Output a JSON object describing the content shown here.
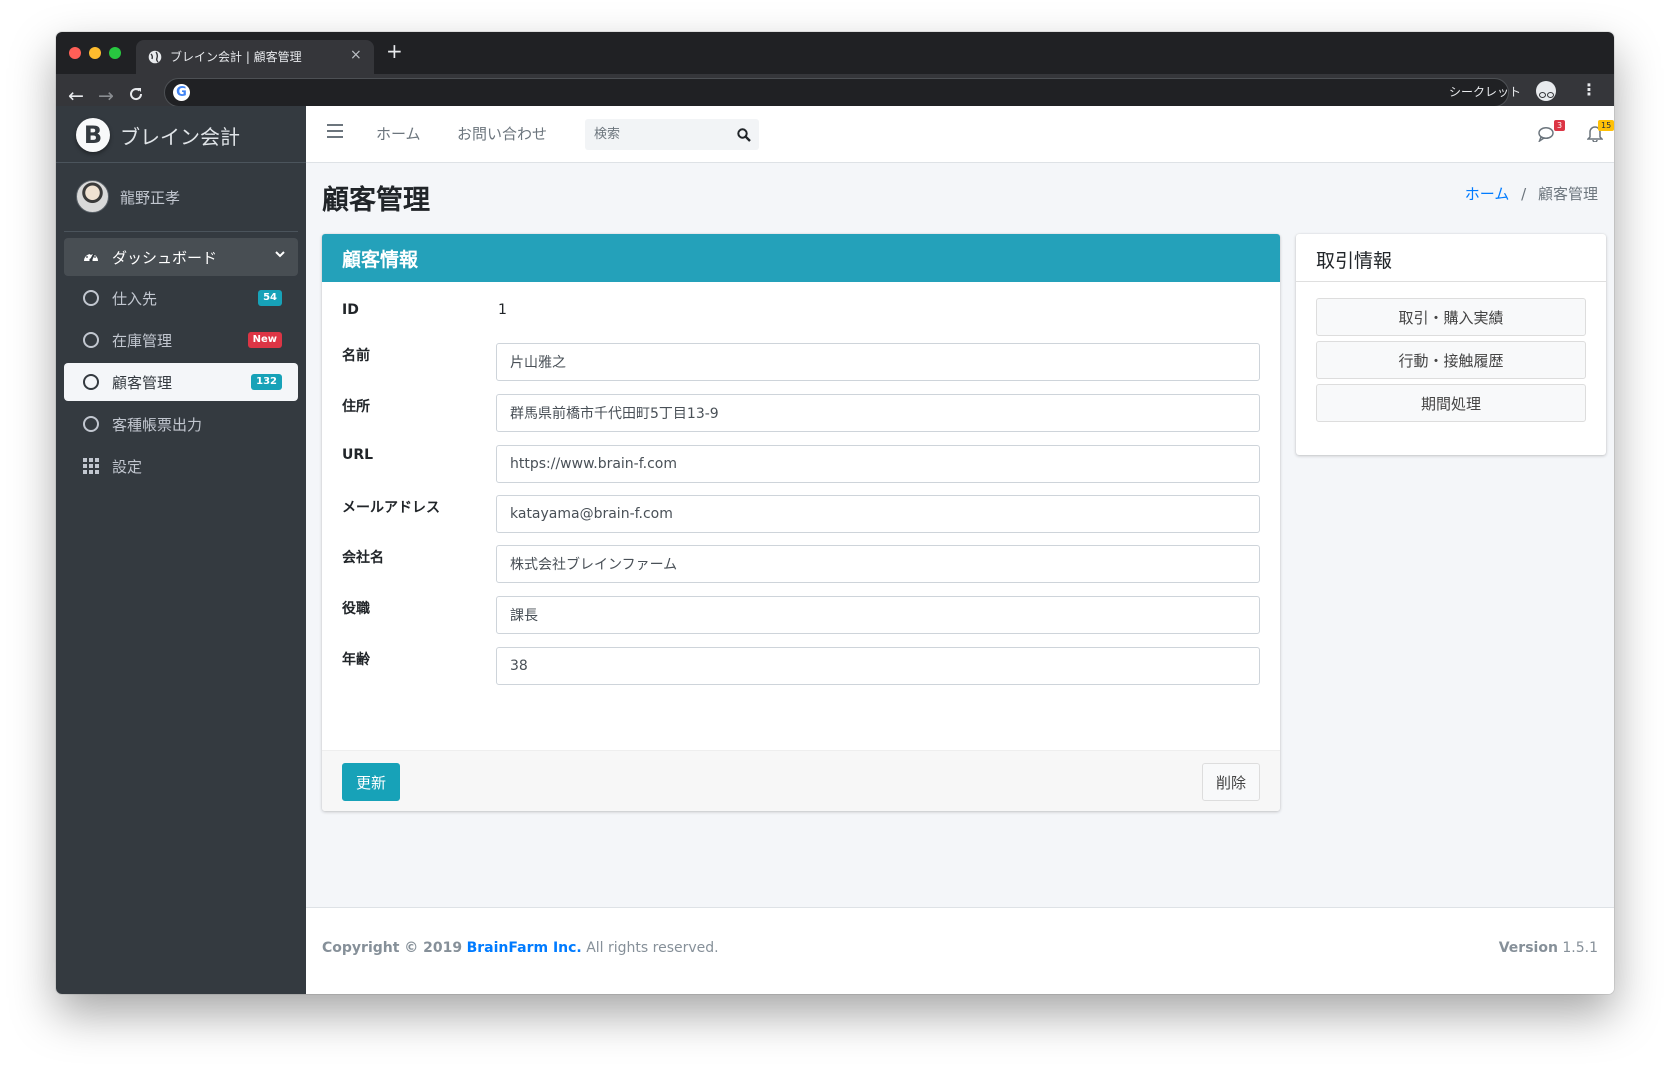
{
  "browser": {
    "tab_title": "ブレイン会計 | 顧客管理",
    "tab_close": "×",
    "new_tab": "+",
    "back": "←",
    "forward": "→",
    "reload": "C",
    "google_icon": "G",
    "incognito_label": "シークレット",
    "menu": "⋮"
  },
  "sidebar": {
    "brand_logo": "B",
    "brand_name": "ブレイン会計",
    "user_name": "龍野正孝",
    "items": [
      {
        "label": "ダッシュボード",
        "icon": "tachometer-icon"
      },
      {
        "label": "仕入先",
        "icon": "circle-icon",
        "badge": "54",
        "badge_color": "#17a2b8"
      },
      {
        "label": "在庫管理",
        "icon": "circle-icon",
        "badge": "New",
        "badge_color": "#dc3545"
      },
      {
        "label": "顧客管理",
        "icon": "circle-icon",
        "badge": "132",
        "badge_color": "#17a2b8",
        "active": true
      },
      {
        "label": "客種帳票出力",
        "icon": "circle-icon"
      },
      {
        "label": "設定",
        "icon": "grid-icon"
      }
    ]
  },
  "topnav": {
    "menu_icon": "hamburger-icon",
    "home": "ホーム",
    "contact": "お問い合わせ",
    "search_placeholder": "検索",
    "messages_count": "3",
    "notifications_count": "15"
  },
  "page": {
    "title": "顧客管理",
    "breadcrumb_home": "ホーム",
    "breadcrumb_sep": "/",
    "breadcrumb_current": "顧客管理"
  },
  "customer_card": {
    "title": "顧客情報",
    "id_label": "ID",
    "id_value": "1",
    "fields": [
      {
        "label": "名前",
        "value": "片山雅之"
      },
      {
        "label": "住所",
        "value": "群馬県前橋市千代田町5丁目13-9"
      },
      {
        "label": "URL",
        "value": "https://www.brain-f.com"
      },
      {
        "label": "メールアドレス",
        "value": "katayama@brain-f.com"
      },
      {
        "label": "会社名",
        "value": "株式会社ブレインファーム"
      },
      {
        "label": "役職",
        "value": "課長"
      },
      {
        "label": "年齢",
        "value": "38"
      }
    ],
    "update_label": "更新",
    "delete_label": "削除"
  },
  "transactions_card": {
    "title": "取引情報",
    "buttons": [
      "取引・購入実績",
      "行動・接触履歴",
      "期間処理"
    ]
  },
  "footer": {
    "copyright": "Copyright © 2019",
    "company": "BrainFarm Inc.",
    "rights": "All rights reserved.",
    "version_label": "Version",
    "version": "1.5.1"
  },
  "colors": {
    "sidebar_bg": "#343a40",
    "card_header": "#24a1ba",
    "primary_link": "#007bff",
    "update_button": "#17a2b8"
  }
}
